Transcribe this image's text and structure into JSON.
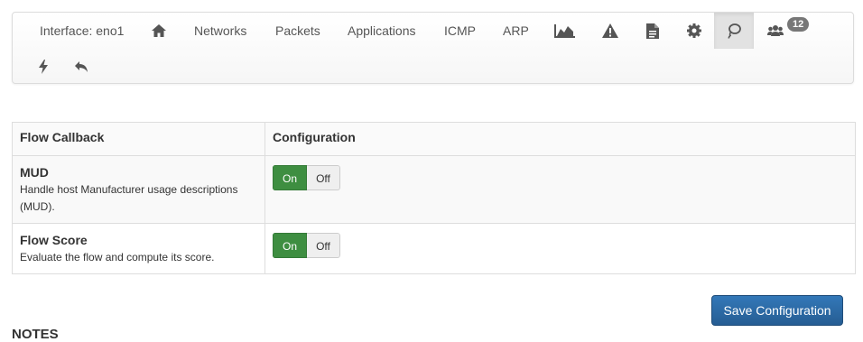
{
  "navbar": {
    "interface_label": "Interface: eno1",
    "links": {
      "networks": "Networks",
      "packets": "Packets",
      "applications": "Applications",
      "icmp": "ICMP",
      "arp": "ARP"
    },
    "icons": [
      "home-icon",
      "area-chart-icon",
      "warning-icon",
      "file-icon",
      "gear-icon",
      "lasso-icon",
      "users-icon",
      "bolt-icon",
      "reply-icon"
    ],
    "hosts_badge": "12"
  },
  "table": {
    "headers": {
      "callback": "Flow Callback",
      "configuration": "Configuration"
    },
    "rows": [
      {
        "title": "MUD",
        "description": "Handle host Manufacturer usage descriptions (MUD).",
        "on_label": "On",
        "off_label": "Off",
        "state": "On"
      },
      {
        "title": "Flow Score",
        "description": "Evaluate the flow and compute its score.",
        "on_label": "On",
        "off_label": "Off",
        "state": "On"
      }
    ]
  },
  "save_button": "Save Configuration",
  "notes_heading": "NOTES",
  "colors": {
    "toggle_on": "#3e8e41",
    "save_button": "#2b6ca3"
  }
}
